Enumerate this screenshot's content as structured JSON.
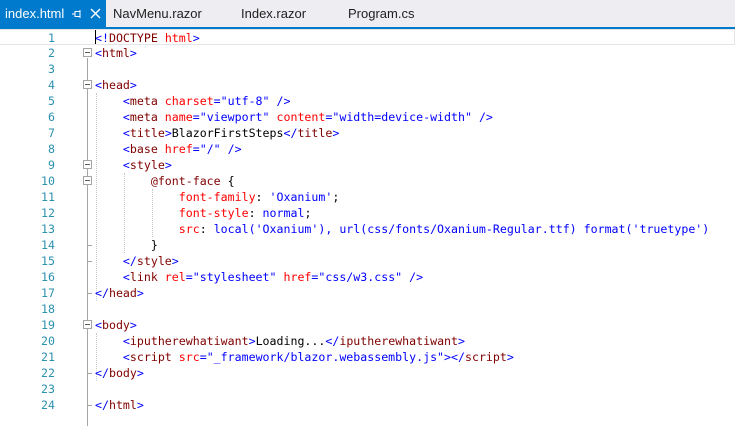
{
  "tabs": [
    {
      "label": "index.html",
      "active": true,
      "pinned": true
    },
    {
      "label": "NavMenu.razor",
      "active": false
    },
    {
      "label": "Index.razor",
      "active": false
    },
    {
      "label": "Program.cs",
      "active": false
    }
  ],
  "colors": {
    "tab_active_bg": "#007acc",
    "tab_strip_bg": "#eeeef2",
    "line_number": "#2b91af",
    "tag": "#800000",
    "attribute": "#ff0000",
    "value": "#0000ff"
  },
  "lines": [
    {
      "n": "1",
      "tokens": [
        [
          "b",
          "<!"
        ],
        [
          "g",
          "DOCTYPE"
        ],
        [
          "a",
          " html"
        ],
        [
          "b",
          ">"
        ]
      ]
    },
    {
      "n": "2",
      "tokens": [
        [
          "b",
          "<"
        ],
        [
          "g",
          "html"
        ],
        [
          "b",
          ">"
        ]
      ]
    },
    {
      "n": "3",
      "tokens": []
    },
    {
      "n": "4",
      "tokens": [
        [
          "b",
          "<"
        ],
        [
          "g",
          "head"
        ],
        [
          "b",
          ">"
        ]
      ]
    },
    {
      "n": "5",
      "tokens": [
        [
          "t",
          "    "
        ],
        [
          "b",
          "<"
        ],
        [
          "g",
          "meta"
        ],
        [
          "a",
          " charset"
        ],
        [
          "b",
          "="
        ],
        [
          "v",
          "\"utf-8\""
        ],
        [
          "b",
          " />"
        ]
      ]
    },
    {
      "n": "6",
      "tokens": [
        [
          "t",
          "    "
        ],
        [
          "b",
          "<"
        ],
        [
          "g",
          "meta"
        ],
        [
          "a",
          " name"
        ],
        [
          "b",
          "="
        ],
        [
          "v",
          "\"viewport\""
        ],
        [
          "a",
          " content"
        ],
        [
          "b",
          "="
        ],
        [
          "v",
          "\"width=device-width\""
        ],
        [
          "b",
          " />"
        ]
      ]
    },
    {
      "n": "7",
      "tokens": [
        [
          "t",
          "    "
        ],
        [
          "b",
          "<"
        ],
        [
          "g",
          "title"
        ],
        [
          "b",
          ">"
        ],
        [
          "t",
          "BlazorFirstSteps"
        ],
        [
          "b",
          "</"
        ],
        [
          "g",
          "title"
        ],
        [
          "b",
          ">"
        ]
      ]
    },
    {
      "n": "8",
      "tokens": [
        [
          "t",
          "    "
        ],
        [
          "b",
          "<"
        ],
        [
          "g",
          "base"
        ],
        [
          "a",
          " href"
        ],
        [
          "b",
          "="
        ],
        [
          "v",
          "\"/\""
        ],
        [
          "b",
          " />"
        ]
      ]
    },
    {
      "n": "9",
      "tokens": [
        [
          "t",
          "    "
        ],
        [
          "b",
          "<"
        ],
        [
          "g",
          "style"
        ],
        [
          "b",
          ">"
        ]
      ]
    },
    {
      "n": "10",
      "tokens": [
        [
          "t",
          "        "
        ],
        [
          "g",
          "@font-face"
        ],
        [
          "t",
          " {"
        ]
      ]
    },
    {
      "n": "11",
      "tokens": [
        [
          "t",
          "            "
        ],
        [
          "a",
          "font-family"
        ],
        [
          "t",
          ": "
        ],
        [
          "v",
          "'Oxanium'"
        ],
        [
          "t",
          ";"
        ]
      ]
    },
    {
      "n": "12",
      "tokens": [
        [
          "t",
          "            "
        ],
        [
          "a",
          "font-style"
        ],
        [
          "t",
          ": "
        ],
        [
          "v",
          "normal"
        ],
        [
          "t",
          ";"
        ]
      ]
    },
    {
      "n": "13",
      "tokens": [
        [
          "t",
          "            "
        ],
        [
          "a",
          "src"
        ],
        [
          "t",
          ": "
        ],
        [
          "v",
          "local('Oxanium'), url(css/fonts/Oxanium-Regular.ttf) format('truetype')"
        ]
      ]
    },
    {
      "n": "14",
      "tokens": [
        [
          "t",
          "        }"
        ]
      ]
    },
    {
      "n": "15",
      "tokens": [
        [
          "t",
          "    "
        ],
        [
          "b",
          "</"
        ],
        [
          "g",
          "style"
        ],
        [
          "b",
          ">"
        ]
      ]
    },
    {
      "n": "16",
      "tokens": [
        [
          "t",
          "    "
        ],
        [
          "b",
          "<"
        ],
        [
          "g",
          "link"
        ],
        [
          "a",
          " rel"
        ],
        [
          "b",
          "="
        ],
        [
          "v",
          "\"stylesheet\""
        ],
        [
          "a",
          " href"
        ],
        [
          "b",
          "="
        ],
        [
          "v",
          "\"css/w3.css\""
        ],
        [
          "b",
          " />"
        ]
      ]
    },
    {
      "n": "17",
      "tokens": [
        [
          "b",
          "</"
        ],
        [
          "g",
          "head"
        ],
        [
          "b",
          ">"
        ]
      ]
    },
    {
      "n": "18",
      "tokens": []
    },
    {
      "n": "19",
      "tokens": [
        [
          "b",
          "<"
        ],
        [
          "g",
          "body"
        ],
        [
          "b",
          ">"
        ]
      ]
    },
    {
      "n": "20",
      "tokens": [
        [
          "t",
          "    "
        ],
        [
          "b",
          "<"
        ],
        [
          "g",
          "iputherewhatiwant"
        ],
        [
          "b",
          ">"
        ],
        [
          "t",
          "Loading..."
        ],
        [
          "b",
          "</"
        ],
        [
          "g",
          "iputherewhatiwant"
        ],
        [
          "b",
          ">"
        ]
      ]
    },
    {
      "n": "21",
      "tokens": [
        [
          "t",
          "    "
        ],
        [
          "b",
          "<"
        ],
        [
          "g",
          "script"
        ],
        [
          "a",
          " src"
        ],
        [
          "b",
          "="
        ],
        [
          "v",
          "\"_framework/blazor.webassembly.js\""
        ],
        [
          "b",
          "></"
        ],
        [
          "g",
          "script"
        ],
        [
          "b",
          ">"
        ]
      ]
    },
    {
      "n": "22",
      "tokens": [
        [
          "b",
          "</"
        ],
        [
          "g",
          "body"
        ],
        [
          "b",
          ">"
        ]
      ]
    },
    {
      "n": "23",
      "tokens": []
    },
    {
      "n": "24",
      "tokens": [
        [
          "b",
          "</"
        ],
        [
          "g",
          "html"
        ],
        [
          "b",
          ">"
        ]
      ]
    }
  ]
}
